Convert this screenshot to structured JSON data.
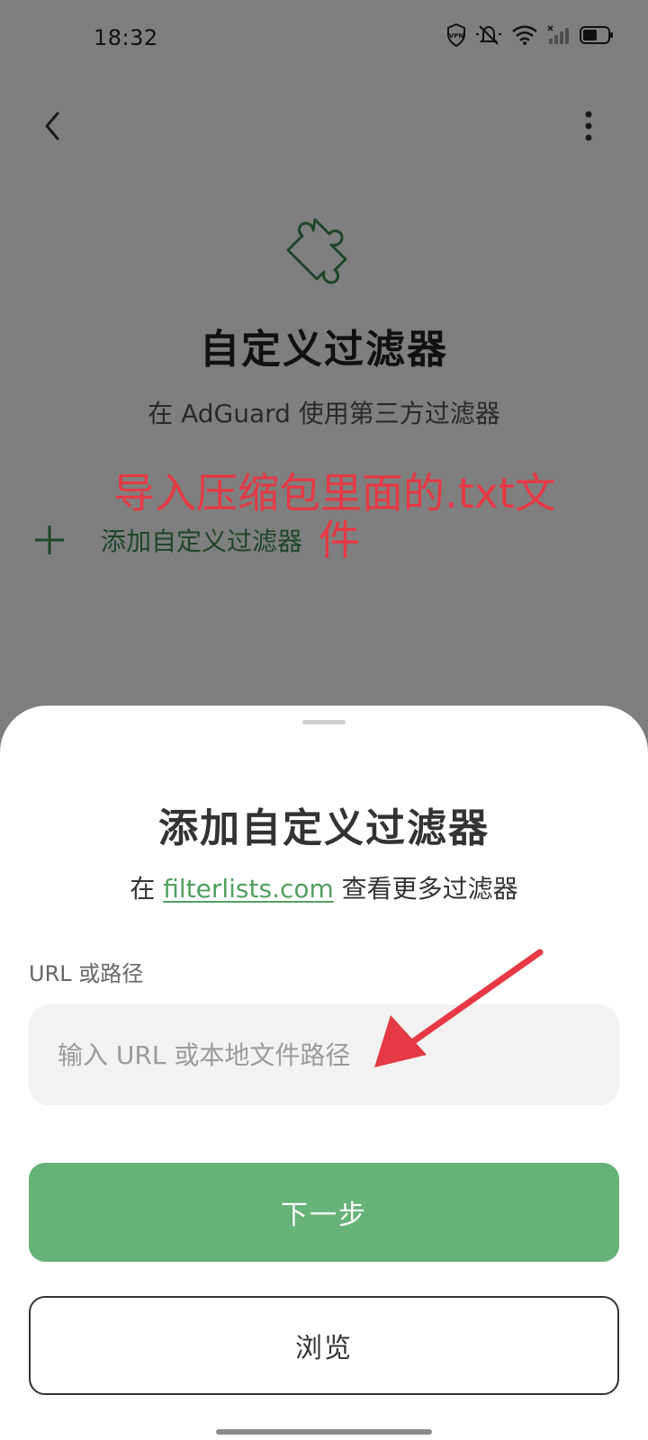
{
  "status_bar": {
    "time": "18:32",
    "icons": [
      "vpn-icon",
      "mute-bell-icon",
      "wifi-icon",
      "signal-icon",
      "battery-icon"
    ]
  },
  "page": {
    "title": "自定义过滤器",
    "subtitle": "在 AdGuard 使用第三方过滤器",
    "add_filter_label": "添加自定义过滤器"
  },
  "annotation": {
    "line1": "导入压缩包里面的.txt文",
    "line2": "件",
    "color": "#e53945"
  },
  "sheet": {
    "title": "添加自定义过滤器",
    "subtitle_prefix": "在 ",
    "subtitle_link": "filterlists.com",
    "subtitle_suffix": " 查看更多过滤器",
    "field_label": "URL 或路径",
    "input_value": "",
    "input_placeholder": "输入 URL 或本地文件路径",
    "next_button": "下一步",
    "browse_button": "浏览"
  },
  "colors": {
    "accent": "#66b278",
    "link": "#52a061",
    "annotation": "#e53945"
  }
}
